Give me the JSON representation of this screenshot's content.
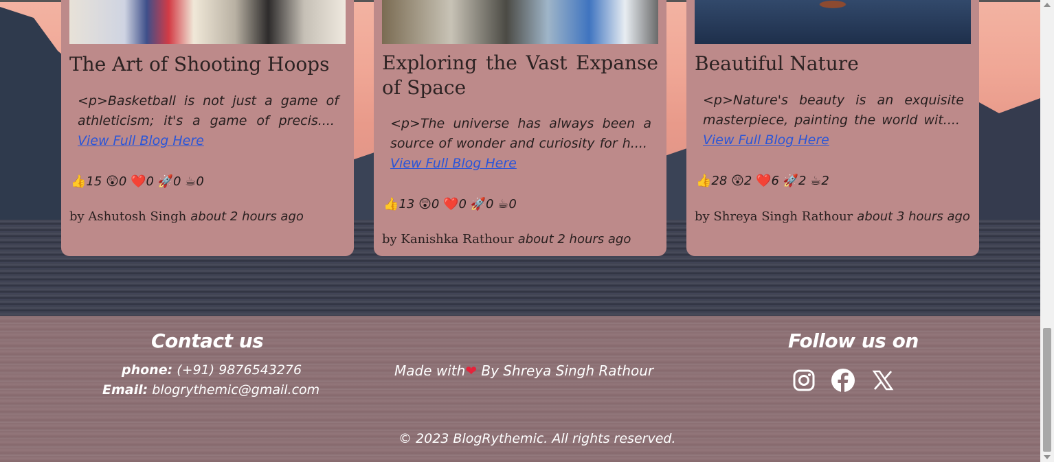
{
  "cards": [
    {
      "title": "The Art of Shooting Hoops",
      "excerpt": "<p>Basketball is not just a game of athleticism; it's a game of precis....",
      "link": "View Full Blog Here",
      "reactions": {
        "like": "15",
        "wow": "0",
        "love": "0",
        "rocket": "0",
        "coffee": "0"
      },
      "author": "by Ashutosh Singh",
      "time": "about 2 hours ago",
      "image_icon": "basketball-graffiti-image"
    },
    {
      "title": "Exploring the Vast Expanse of Space",
      "excerpt": "<p>The universe has always been a source of wonder and curiosity for h....",
      "link": "View Full Blog Here",
      "reactions": {
        "like": "13",
        "wow": "0",
        "love": "0",
        "rocket": "0",
        "coffee": "0"
      },
      "author": "by Kanishka Rathour",
      "time": "about 2 hours ago",
      "image_icon": "astronaut-space-image"
    },
    {
      "title": "Beautiful Nature",
      "excerpt": "<p>Nature's beauty is an exquisite masterpiece, painting the world wit....",
      "link": "View Full Blog Here",
      "reactions": {
        "like": "28",
        "wow": "2",
        "love": "6",
        "rocket": "2",
        "coffee": "2"
      },
      "author": "by Shreya Singh Rathour",
      "time": "about 3 hours ago",
      "image_icon": "nature-tree-image"
    }
  ],
  "reaction_emojis": {
    "like": "👍",
    "wow": "😲",
    "love": "❤️",
    "rocket": "🚀",
    "coffee": "☕"
  },
  "footer": {
    "contact_title": "Contact us",
    "phone_label": "phone:",
    "phone_value": "(+91) 9876543276",
    "email_label": "Email:",
    "email_value": "blogrythemic@gmail.com",
    "made_with_prefix": "Made with",
    "heart": "❤",
    "made_with_suffix": " By Shreya Singh Rathour",
    "follow_title": "Follow us on",
    "social_icons": [
      "instagram-icon",
      "facebook-icon",
      "x-icon"
    ],
    "copyright": "© 2023 BlogRythemic. All rights reserved."
  },
  "colors": {
    "card_bg": "#bd8a8a",
    "link": "#2a55d8",
    "heart": "#e6223a"
  }
}
